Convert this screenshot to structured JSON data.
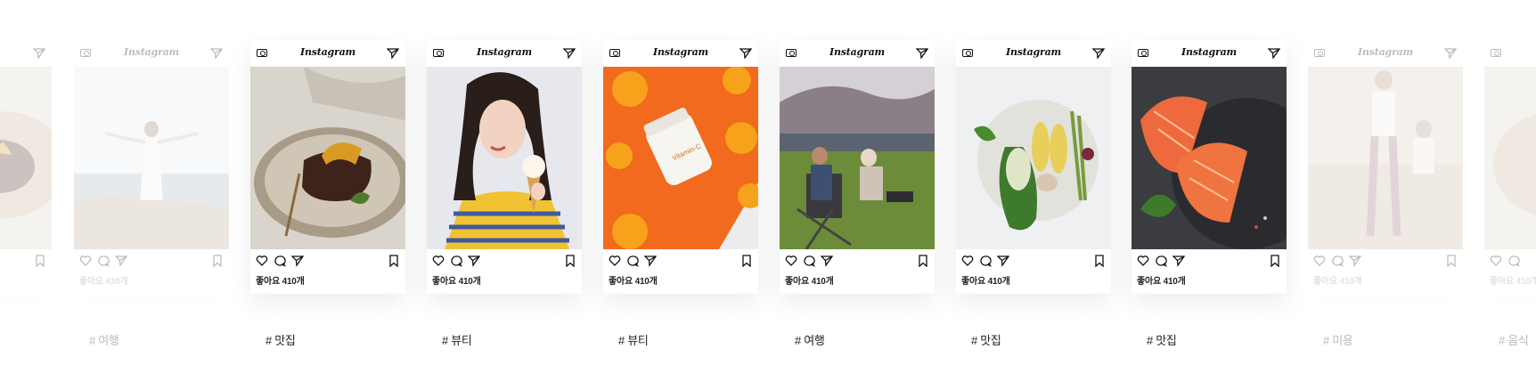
{
  "brand": "Instagram",
  "likes_text": "좋아요 410개",
  "tags": [
    {
      "text": "# 여행",
      "state": "faded"
    },
    {
      "text": "# 맛집",
      "state": "active"
    },
    {
      "text": "# 뷰티",
      "state": "active"
    },
    {
      "text": "# 뷰티",
      "state": "active"
    },
    {
      "text": "# 여행",
      "state": "active"
    },
    {
      "text": "# 맛집",
      "state": "active"
    },
    {
      "text": "# 맛집",
      "state": "active"
    },
    {
      "text": "# 미용",
      "state": "faded"
    },
    {
      "text": "# 음식",
      "state": "faded"
    }
  ],
  "icons": {
    "camera": "camera-icon",
    "send": "send-icon",
    "heart": "heart-icon",
    "comment": "comment-icon",
    "bookmark": "bookmark-icon"
  },
  "vitamin_label": "Vitamin-C"
}
